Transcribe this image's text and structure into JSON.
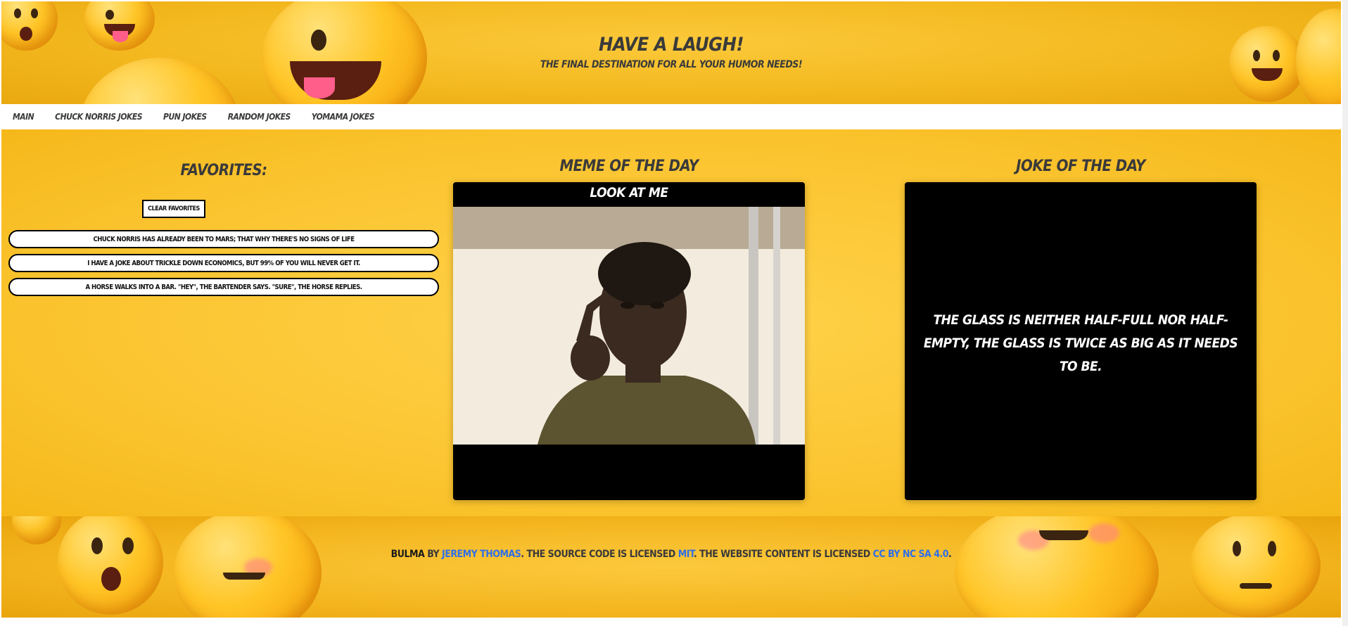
{
  "header": {
    "title": "Have a laugh!",
    "subtitle": "The final destination for all your humor needs!"
  },
  "nav": {
    "items": [
      {
        "label": "Main"
      },
      {
        "label": "Chuck Norris Jokes"
      },
      {
        "label": "Pun Jokes"
      },
      {
        "label": "Random Jokes"
      },
      {
        "label": "Yomama Jokes"
      }
    ]
  },
  "favorites": {
    "title": "Favorites:",
    "clear_label": "Clear Favorites",
    "items": [
      {
        "text": "Chuck Norris has already been to Mars; that why there's no signs of life"
      },
      {
        "text": "I have a joke about trickle down economics, but 99% of you will never get it."
      },
      {
        "text": "A horse walks into a bar. \"Hey\", the bartender says. \"Sure\", the horse replies."
      }
    ]
  },
  "meme": {
    "title": "Meme of the day",
    "caption": "LOOK AT ME"
  },
  "joke": {
    "title": "Joke of the day",
    "text": "The glass is neither half-full nor half-empty, the glass is twice as big as it needs to be."
  },
  "footer": {
    "brand": "Bulma",
    "by": " by ",
    "author": "Jeremy Thomas",
    "mid1": ". The source code is licensed ",
    "license_code": "MIT",
    "mid2": ". The website content is licensed ",
    "license_content": "CC BY NC SA 4.0",
    "end": "."
  },
  "colors": {
    "accent_yellow": "#fbc531",
    "link_blue": "#2f6fe8",
    "text_dark": "#3a3a3a"
  }
}
